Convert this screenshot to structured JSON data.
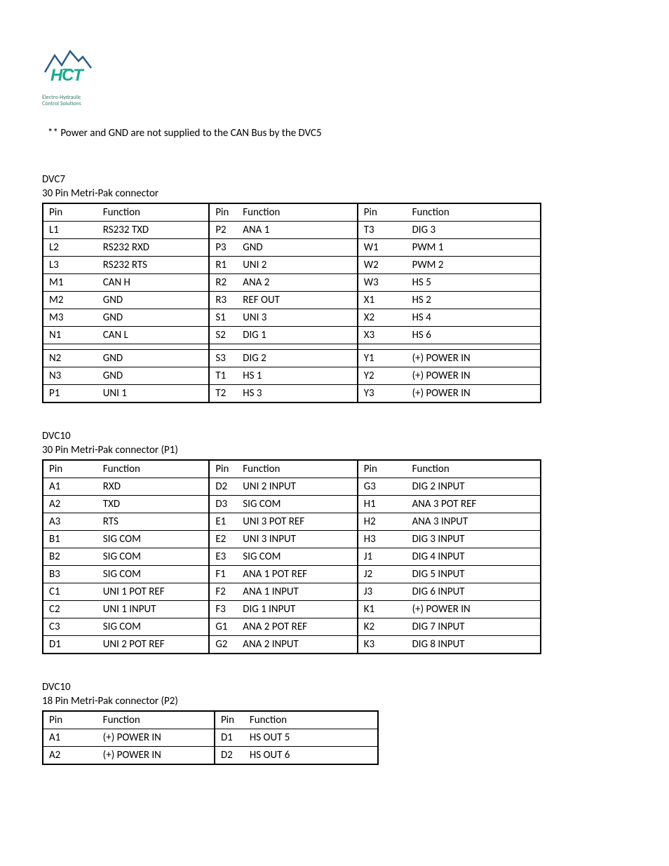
{
  "logo": {
    "brand": "HCT",
    "tagline1": "Electro-Hydraulic",
    "tagline2": "Control Solutions"
  },
  "note": "** Power and GND are not supplied to the CAN Bus by the DVC5",
  "table1": {
    "title": "DVC7",
    "subtitle": "30 Pin Metri-Pak connector",
    "headers": [
      "Pin",
      "Function",
      "Pin",
      "Function",
      "Pin",
      "Function"
    ],
    "rows": [
      {
        "p1": "L1",
        "f1": "RS232 TXD",
        "p2": "P2",
        "f2": "ANA 1",
        "p3": "T3",
        "f3": "DIG 3"
      },
      {
        "p1": "L2",
        "f1": "RS232 RXD",
        "p2": "P3",
        "f2": "GND",
        "p3": "W1",
        "f3": "PWM 1"
      },
      {
        "p1": "L3",
        "f1": "RS232 RTS",
        "p2": "R1",
        "f2": "UNI 2",
        "p3": "W2",
        "f3": "PWM 2"
      },
      {
        "p1": "M1",
        "f1": "CAN H",
        "p2": "R2",
        "f2": "ANA 2",
        "p3": "W3",
        "f3": "HS 5"
      },
      {
        "p1": "M2",
        "f1": "GND",
        "p2": "R3",
        "f2": "REF OUT",
        "p3": "X1",
        "f3": "HS 2"
      },
      {
        "p1": "M3",
        "f1": "GND",
        "p2": "S1",
        "f2": "UNI 3",
        "p3": "X2",
        "f3": "HS 4"
      },
      {
        "p1": "N1",
        "f1": "CAN L",
        "p2": "S2",
        "f2": "DIG 1",
        "p3": "X3",
        "f3": "HS 6",
        "gap_after": true
      },
      {
        "p1": "N2",
        "f1": "GND",
        "p2": "S3",
        "f2": "DIG 2",
        "p3": "Y1",
        "f3": "(+) POWER IN"
      },
      {
        "p1": "N3",
        "f1": "GND",
        "p2": "T1",
        "f2": "HS 1",
        "p3": "Y2",
        "f3": "(+) POWER IN"
      },
      {
        "p1": "P1",
        "f1": "UNI 1",
        "p2": "T2",
        "f2": "HS 3",
        "p3": "Y3",
        "f3": "(+) POWER IN"
      }
    ]
  },
  "table2": {
    "title": "DVC10",
    "subtitle": "30 Pin Metri-Pak connector (P1)",
    "headers": [
      "Pin",
      "Function",
      "Pin",
      "Function",
      "Pin",
      "Function"
    ],
    "rows": [
      {
        "p1": "A1",
        "f1": "RXD",
        "p2": "D2",
        "f2": "UNI 2 INPUT",
        "p3": "G3",
        "f3": "DIG 2 INPUT"
      },
      {
        "p1": "A2",
        "f1": "TXD",
        "p2": "D3",
        "f2": "SIG COM",
        "p3": "H1",
        "f3": "ANA 3 POT REF"
      },
      {
        "p1": "A3",
        "f1": "RTS",
        "p2": "E1",
        "f2": "UNI 3 POT REF",
        "p3": "H2",
        "f3": "ANA 3 INPUT"
      },
      {
        "p1": "B1",
        "f1": "SIG COM",
        "p2": "E2",
        "f2": "UNI 3 INPUT",
        "p3": "H3",
        "f3": "DIG 3 INPUT"
      },
      {
        "p1": "B2",
        "f1": "SIG COM",
        "p2": "E3",
        "f2": "SIG COM",
        "p3": "J1",
        "f3": "DIG 4 INPUT"
      },
      {
        "p1": "B3",
        "f1": "SIG COM",
        "p2": "F1",
        "f2": "ANA 1 POT REF",
        "p3": "J2",
        "f3": "DIG 5 INPUT"
      },
      {
        "p1": "C1",
        "f1": "UNI 1 POT REF",
        "p2": "F2",
        "f2": "ANA 1 INPUT",
        "p3": "J3",
        "f3": "DIG 6 INPUT"
      },
      {
        "p1": "C2",
        "f1": "UNI 1 INPUT",
        "p2": "F3",
        "f2": "DIG 1 INPUT",
        "p3": "K1",
        "f3": "(+) POWER IN"
      },
      {
        "p1": "C3",
        "f1": "SIG COM",
        "p2": "G1",
        "f2": "ANA 2 POT REF",
        "p3": "K2",
        "f3": "DIG 7 INPUT"
      },
      {
        "p1": "D1",
        "f1": "UNI 2 POT REF",
        "p2": "G2",
        "f2": "ANA 2 INPUT",
        "p3": "K3",
        "f3": "DIG 8 INPUT"
      }
    ]
  },
  "table3": {
    "title": "DVC10",
    "subtitle": "18 Pin Metri-Pak connector (P2)",
    "headers": [
      "Pin",
      "Function",
      "Pin",
      "Function"
    ],
    "rows": [
      {
        "p1": "A1",
        "f1": "(+) POWER IN",
        "p2": "D1",
        "f2": "HS OUT 5"
      },
      {
        "p1": "A2",
        "f1": "(+) POWER IN",
        "p2": "D2",
        "f2": "HS OUT 6"
      }
    ]
  }
}
